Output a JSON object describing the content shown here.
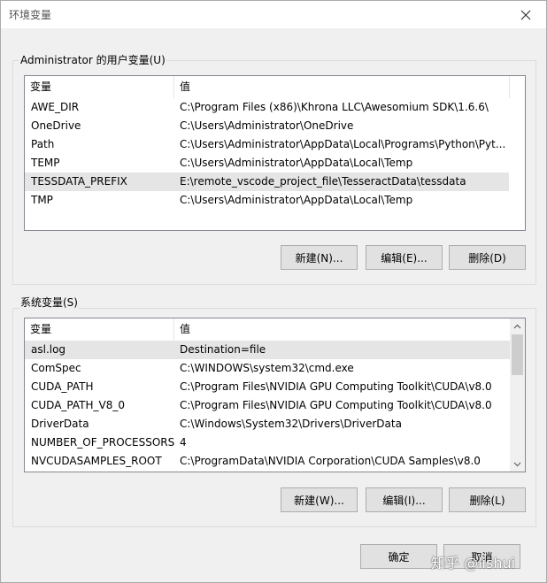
{
  "window": {
    "title": "环境变量"
  },
  "user_vars": {
    "group_label": "Administrator 的用户变量(U)",
    "columns": [
      "变量",
      "值"
    ],
    "rows": [
      {
        "name": "AWE_DIR",
        "value": "C:\\Program Files (x86)\\Khrona LLC\\Awesomium SDK\\1.6.6\\"
      },
      {
        "name": "OneDrive",
        "value": "C:\\Users\\Administrator\\OneDrive"
      },
      {
        "name": "Path",
        "value": "C:\\Users\\Administrator\\AppData\\Local\\Programs\\Python\\Pyt..."
      },
      {
        "name": "TEMP",
        "value": "C:\\Users\\Administrator\\AppData\\Local\\Temp"
      },
      {
        "name": "TESSDATA_PREFIX",
        "value": "E:\\remote_vscode_project_file\\TesseractData\\tessdata"
      },
      {
        "name": "TMP",
        "value": "C:\\Users\\Administrator\\AppData\\Local\\Temp"
      }
    ],
    "buttons": {
      "new": "新建(N)...",
      "edit": "编辑(E)...",
      "delete": "删除(D)"
    }
  },
  "system_vars": {
    "group_label": "系统变量(S)",
    "columns": [
      "变量",
      "值"
    ],
    "rows": [
      {
        "name": "asl.log",
        "value": "Destination=file"
      },
      {
        "name": "ComSpec",
        "value": "C:\\WINDOWS\\system32\\cmd.exe"
      },
      {
        "name": "CUDA_PATH",
        "value": "C:\\Program Files\\NVIDIA GPU Computing Toolkit\\CUDA\\v8.0"
      },
      {
        "name": "CUDA_PATH_V8_0",
        "value": "C:\\Program Files\\NVIDIA GPU Computing Toolkit\\CUDA\\v8.0"
      },
      {
        "name": "DriverData",
        "value": "C:\\Windows\\System32\\Drivers\\DriverData"
      },
      {
        "name": "NUMBER_OF_PROCESSORS",
        "value": "4"
      },
      {
        "name": "NVCUDASAMPLES_ROOT",
        "value": "C:\\ProgramData\\NVIDIA Corporation\\CUDA Samples\\v8.0"
      }
    ],
    "buttons": {
      "new": "新建(W)...",
      "edit": "编辑(I)...",
      "delete": "删除(L)"
    }
  },
  "dialog_buttons": {
    "ok": "确定",
    "cancel": "取消"
  },
  "watermark": {
    "text": "知乎 @lishui"
  },
  "colors": {
    "selected_row": "#e5e5e5",
    "button_bg": "#e1e1e1",
    "dialog_bg": "#f0f0f0"
  },
  "icons": {
    "close": "close-icon",
    "scroll_up": "chevron-up-icon",
    "scroll_down": "chevron-down-icon"
  }
}
